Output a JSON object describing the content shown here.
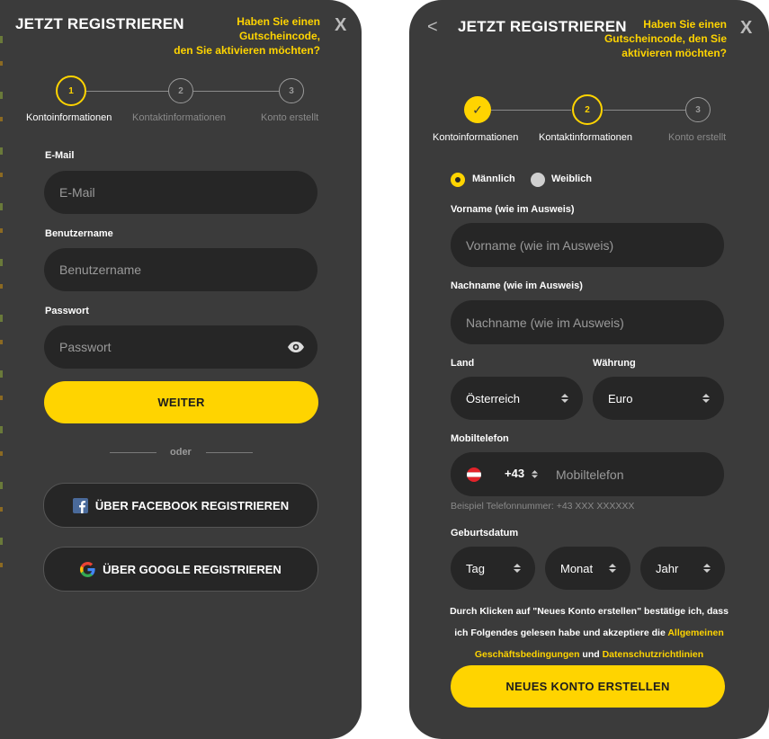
{
  "left": {
    "title": "JETZT REGISTRIEREN",
    "voucher_line1": "Haben Sie einen Gutscheincode,",
    "voucher_line2": "den Sie aktivieren möchten?",
    "close": "X",
    "steps": [
      {
        "num": "1",
        "label": "Kontoinformationen"
      },
      {
        "num": "2",
        "label": "Kontaktinformationen"
      },
      {
        "num": "3",
        "label": "Konto erstellt"
      }
    ],
    "email_label": "E-Mail",
    "email_placeholder": "E-Mail",
    "username_label": "Benutzername",
    "username_placeholder": "Benutzername",
    "password_label": "Passwort",
    "password_placeholder": "Passwort",
    "next_button": "WEITER",
    "or_text": "oder",
    "facebook_button": "ÜBER FACEBOOK REGISTRIEREN",
    "google_button": "ÜBER GOOGLE REGISTRIEREN"
  },
  "right": {
    "title": "JETZT REGISTRIEREN",
    "back": "<",
    "voucher_line1": "Haben Sie einen",
    "voucher_line2": "Gutscheincode, den Sie",
    "voucher_line3": "aktivieren möchten?",
    "close": "X",
    "steps": [
      {
        "num": "✓",
        "label": "Kontoinformationen"
      },
      {
        "num": "2",
        "label": "Kontaktinformationen"
      },
      {
        "num": "3",
        "label": "Konto erstellt"
      }
    ],
    "gender_male": "Männlich",
    "gender_female": "Weiblich",
    "firstname_label": "Vorname (wie im Ausweis)",
    "firstname_placeholder": "Vorname (wie im Ausweis)",
    "lastname_label": "Nachname (wie im Ausweis)",
    "lastname_placeholder": "Nachname (wie im Ausweis)",
    "country_label": "Land",
    "country_value": "Österreich",
    "currency_label": "Währung",
    "currency_value": "Euro",
    "mobile_label": "Mobiltelefon",
    "dial_code": "+43",
    "mobile_placeholder": "Mobiltelefon",
    "phone_example": "Beispiel Telefonnummer: +43 XXX XXXXXX",
    "birthdate_label": "Geburtsdatum",
    "day": "Tag",
    "month": "Monat",
    "year": "Jahr",
    "terms_text1": "Durch Klicken auf \"Neues Konto erstellen\" bestätige ich, dass ich Folgendes gelesen habe und akzeptiere die ",
    "terms_link1": "Allgemeinen Geschäftsbedingungen",
    "terms_and": " und ",
    "terms_link2": "Datenschutzrichtlinien",
    "create_button": "NEUES KONTO ERSTELLEN"
  },
  "colors": {
    "accent": "#ffd400",
    "panel": "#3b3b3b",
    "input": "#262626"
  },
  "icons": [
    "eye-icon",
    "facebook-icon",
    "google-icon",
    "austria-flag-icon",
    "checkmark-icon"
  ]
}
